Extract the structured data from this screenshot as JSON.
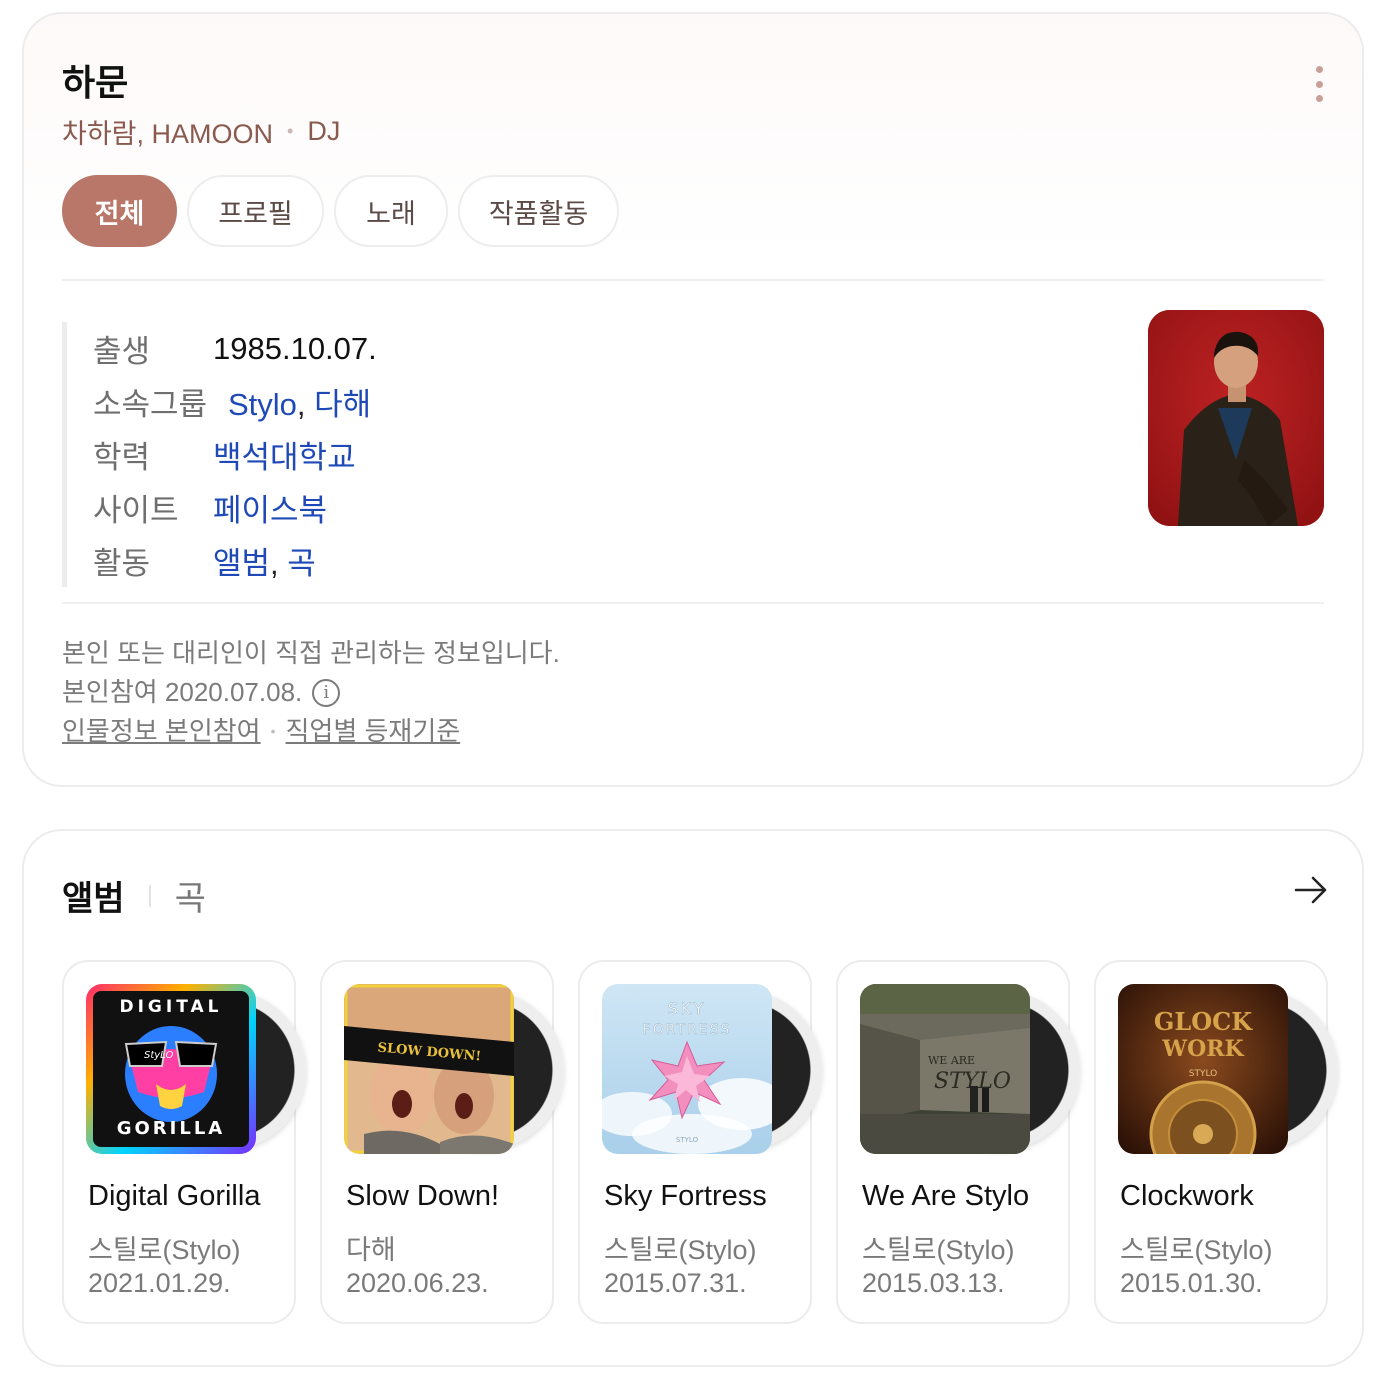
{
  "profile": {
    "name": "하문",
    "aliases": "차하람, HAMOON",
    "occupation": "DJ",
    "tabs": [
      "전체",
      "프로필",
      "노래",
      "작품활동"
    ],
    "info": {
      "birth_label": "출생",
      "birth_value": "1985.10.07.",
      "group_label": "소속그룹",
      "group_link1": "Stylo",
      "group_sep": ", ",
      "group_link2": "다해",
      "education_label": "학력",
      "education_value": "백석대학교",
      "site_label": "사이트",
      "site_value": "페이스북",
      "activity_label": "활동",
      "activity_link1": "앨범",
      "activity_sep": ", ",
      "activity_link2": "곡"
    },
    "note_line1": "본인 또는 대리인이 직접 관리하는 정보입니다.",
    "note_line2": "본인참여 2020.07.08.",
    "info_icon": "i",
    "link_participate": "인물정보 본인참여",
    "link_criteria": "직업별 등재기준"
  },
  "albums_section": {
    "tab_active": "앨범",
    "tab_inactive": "곡",
    "items": [
      {
        "title": "Digital Gorilla",
        "artist": "스틸로(Stylo)",
        "date": "2021.01.29."
      },
      {
        "title": "Slow Down!",
        "artist": "다해",
        "date": "2020.06.23."
      },
      {
        "title": "Sky Fortress",
        "artist": "스틸로(Stylo)",
        "date": "2015.07.31."
      },
      {
        "title": "We Are Stylo",
        "artist": "스틸로(Stylo)",
        "date": "2015.03.13."
      },
      {
        "title": "Clockwork",
        "artist": "스틸로(Stylo)",
        "date": "2015.01.30."
      }
    ]
  },
  "colors": {
    "accent": "#b9776a",
    "link": "#1f49b6",
    "subtitle": "#8a5a4e"
  }
}
